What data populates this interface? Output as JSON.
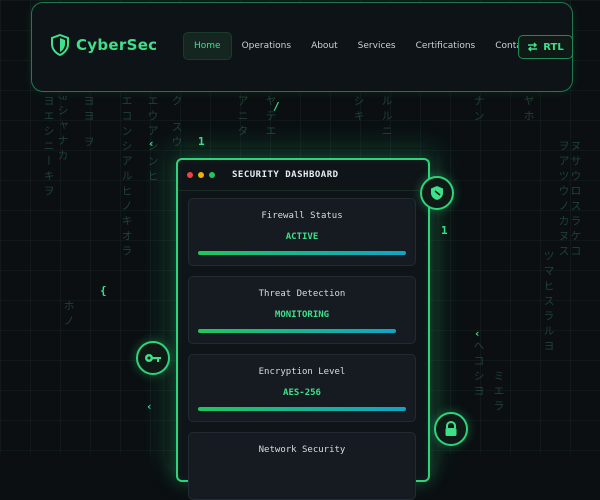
{
  "brand": {
    "name": "CyberSec",
    "icon": "shield-icon"
  },
  "nav": {
    "items": [
      {
        "label": "Home",
        "active": true
      },
      {
        "label": "Operations",
        "active": false
      },
      {
        "label": "About",
        "active": false
      },
      {
        "label": "Services",
        "active": false
      },
      {
        "label": "Certifications",
        "active": false
      },
      {
        "label": "Contact",
        "active": false
      }
    ],
    "rtl_label": "RTL"
  },
  "dashboard": {
    "title": "SECURITY DASHBOARD",
    "window_dots": [
      "#ef4444",
      "#eab308",
      "#22c55e"
    ],
    "cards": [
      {
        "label": "Firewall Status",
        "value": "ACTIVE",
        "progress": 1.0
      },
      {
        "label": "Threat Detection",
        "value": "MONITORING",
        "progress": 0.95
      },
      {
        "label": "Encryption Level",
        "value": "AES-256",
        "progress": 1.0
      },
      {
        "label": "Network Security",
        "value": "",
        "progress": 0
      }
    ]
  },
  "floating_icons": [
    "shield-icon",
    "key-icon",
    "lock-icon"
  ],
  "colors": {
    "accent": "#3ee08a",
    "background": "#0b0f12",
    "panel_border": "#2fd47a"
  }
}
